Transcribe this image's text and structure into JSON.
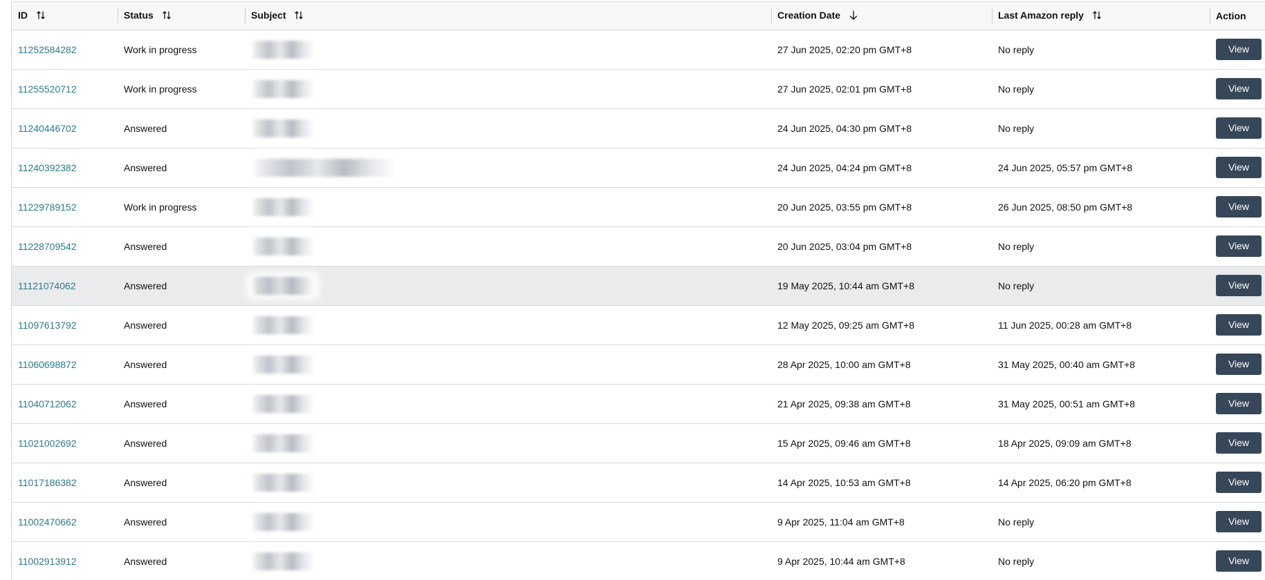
{
  "columns": {
    "id": "ID",
    "status": "Status",
    "subject": "Subject",
    "creation_date": "Creation Date",
    "last_reply": "Last Amazon reply",
    "action": "Action"
  },
  "icons": {
    "sortable": "sort-up-down-icon",
    "sorted_desc": "arrow-down-icon"
  },
  "colors": {
    "link": "#2a7a8c",
    "button_bg": "#37475a",
    "row_highlight": "#e9ebec",
    "header_bg": "#f7f8f8"
  },
  "rows": [
    {
      "id": "11252584282",
      "status": "Work in progress",
      "created": "27 Jun 2025, 02:20 pm GMT+8",
      "reply": "No reply",
      "action": "View"
    },
    {
      "id": "11255520712",
      "status": "Work in progress",
      "created": "27 Jun 2025, 02:01 pm GMT+8",
      "reply": "No reply",
      "action": "View"
    },
    {
      "id": "11240446702",
      "status": "Answered",
      "created": "24 Jun 2025, 04:30 pm GMT+8",
      "reply": "No reply",
      "action": "View"
    },
    {
      "id": "11240392382",
      "status": "Answered",
      "created": "24 Jun 2025, 04:24 pm GMT+8",
      "reply": "24 Jun 2025, 05:57 pm GMT+8",
      "action": "View"
    },
    {
      "id": "11229789152",
      "status": "Work in progress",
      "created": "20 Jun 2025, 03:55 pm GMT+8",
      "reply": "26 Jun 2025, 08:50 pm GMT+8",
      "action": "View"
    },
    {
      "id": "11228709542",
      "status": "Answered",
      "created": "20 Jun 2025, 03:04 pm GMT+8",
      "reply": "No reply",
      "action": "View"
    },
    {
      "id": "11121074062",
      "status": "Answered",
      "created": "19 May 2025, 10:44 am GMT+8",
      "reply": "No reply",
      "action": "View"
    },
    {
      "id": "11097613792",
      "status": "Answered",
      "created": "12 May 2025, 09:25 am GMT+8",
      "reply": "11 Jun 2025, 00:28 am GMT+8",
      "action": "View"
    },
    {
      "id": "11060698872",
      "status": "Answered",
      "created": "28 Apr 2025, 10:00 am GMT+8",
      "reply": "31 May 2025, 00:40 am GMT+8",
      "action": "View"
    },
    {
      "id": "11040712062",
      "status": "Answered",
      "created": "21 Apr 2025, 09:38 am GMT+8",
      "reply": "31 May 2025, 00:51 am GMT+8",
      "action": "View"
    },
    {
      "id": "11021002692",
      "status": "Answered",
      "created": "15 Apr 2025, 09:46 am GMT+8",
      "reply": "18 Apr 2025, 09:09 am GMT+8",
      "action": "View"
    },
    {
      "id": "11017186382",
      "status": "Answered",
      "created": "14 Apr 2025, 10:53 am GMT+8",
      "reply": "14 Apr 2025, 06:20 pm GMT+8",
      "action": "View"
    },
    {
      "id": "11002470662",
      "status": "Answered",
      "created": "9 Apr 2025, 11:04 am GMT+8",
      "reply": "No reply",
      "action": "View"
    },
    {
      "id": "11002913912",
      "status": "Answered",
      "created": "9 Apr 2025, 10:44 am GMT+8",
      "reply": "No reply",
      "action": "View"
    }
  ]
}
